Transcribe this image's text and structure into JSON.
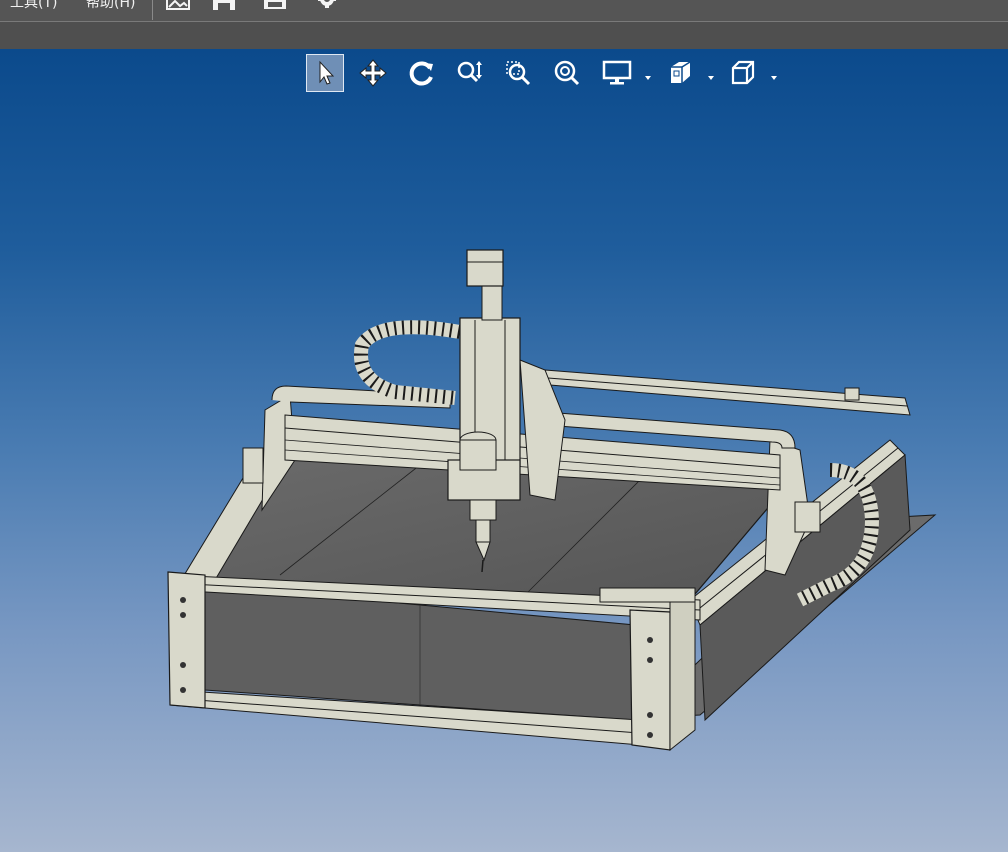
{
  "menu": {
    "tools_label": "工具(T)",
    "help_label": "帮助(H)"
  },
  "toolbar_icons": [
    "image-icon",
    "save-icon",
    "print-icon",
    "gear-icon"
  ],
  "view_toolbar": {
    "tools": [
      "select-arrow-icon",
      "pan-move-icon",
      "rotate-icon",
      "zoom-vertical-icon",
      "zoom-box-icon",
      "zoom-fit-icon",
      "display-mode-icon",
      "view-cube-icon",
      "view-box-icon"
    ],
    "active_tool": "select-arrow-icon"
  },
  "colors": {
    "viewport_top": "#0b4a8c",
    "viewport_bottom": "#a6b6cf",
    "model_part": "#d9d9cb",
    "model_bed": "#5e5e5e",
    "menubar": "#555555"
  }
}
